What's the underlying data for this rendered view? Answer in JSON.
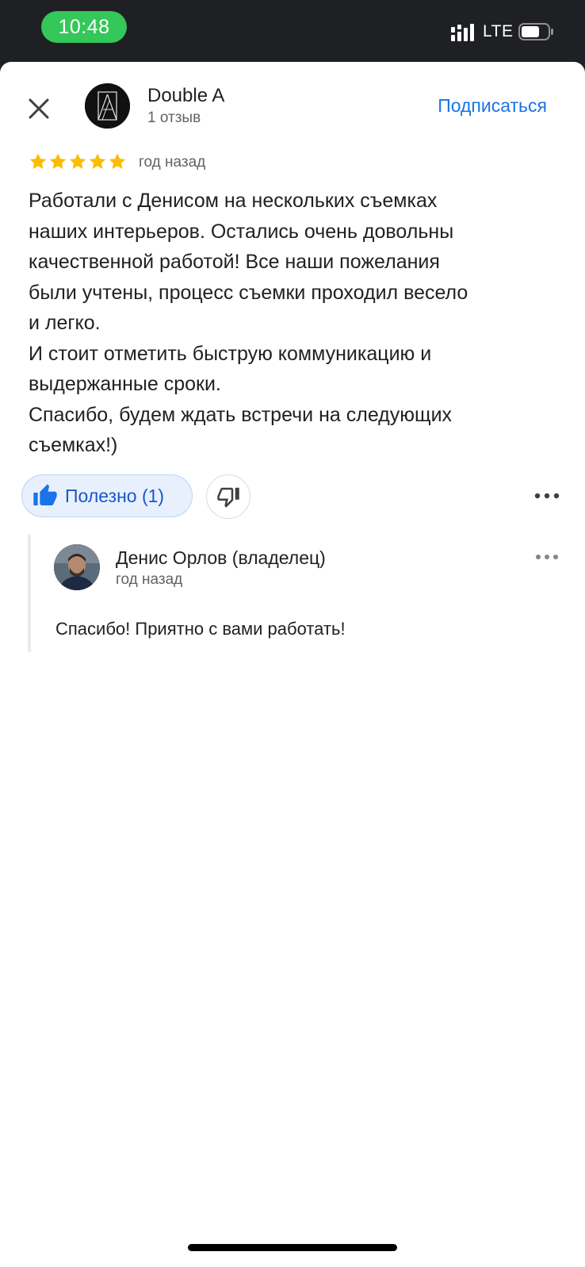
{
  "status_bar": {
    "time": "10:48",
    "network": "LTE",
    "icons": [
      "signal-bars-icon",
      "battery-icon"
    ],
    "time_pill_color": "#34c759"
  },
  "header": {
    "close_icon": "close-icon",
    "reviewer_name": "Double A",
    "review_count": "1 отзыв",
    "subscribe_label": "Подписаться"
  },
  "review": {
    "rating": 5,
    "rating_max": 5,
    "time": "год назад",
    "text": "Работали с Денисом на нескольких съемках\nнаших интерьеров. Остались очень довольны\nкачественной работой! Все наши пожелания\nбыли учтены, процесс съемки проходил весело\nи легко.\nИ стоит отметить быструю коммуникацию и\nвыдержанные сроки.\nСпасибо, будем ждать встречи на следующих\nсъемках!)"
  },
  "actions": {
    "helpful_label": "Полезно (1)",
    "icons": [
      "thumb-up-icon",
      "thumb-down-icon",
      "more-icon"
    ]
  },
  "reply": {
    "owner_name": "Денис Орлов (владелец)",
    "time": "год назад",
    "text": "Спасибо! Приятно с вами работать!"
  },
  "colors": {
    "accent": "#1a73e8",
    "star": "#fbbc04",
    "helpful_bg": "#e8f0fe",
    "text_primary": "#202124",
    "text_secondary": "#5f6368"
  }
}
